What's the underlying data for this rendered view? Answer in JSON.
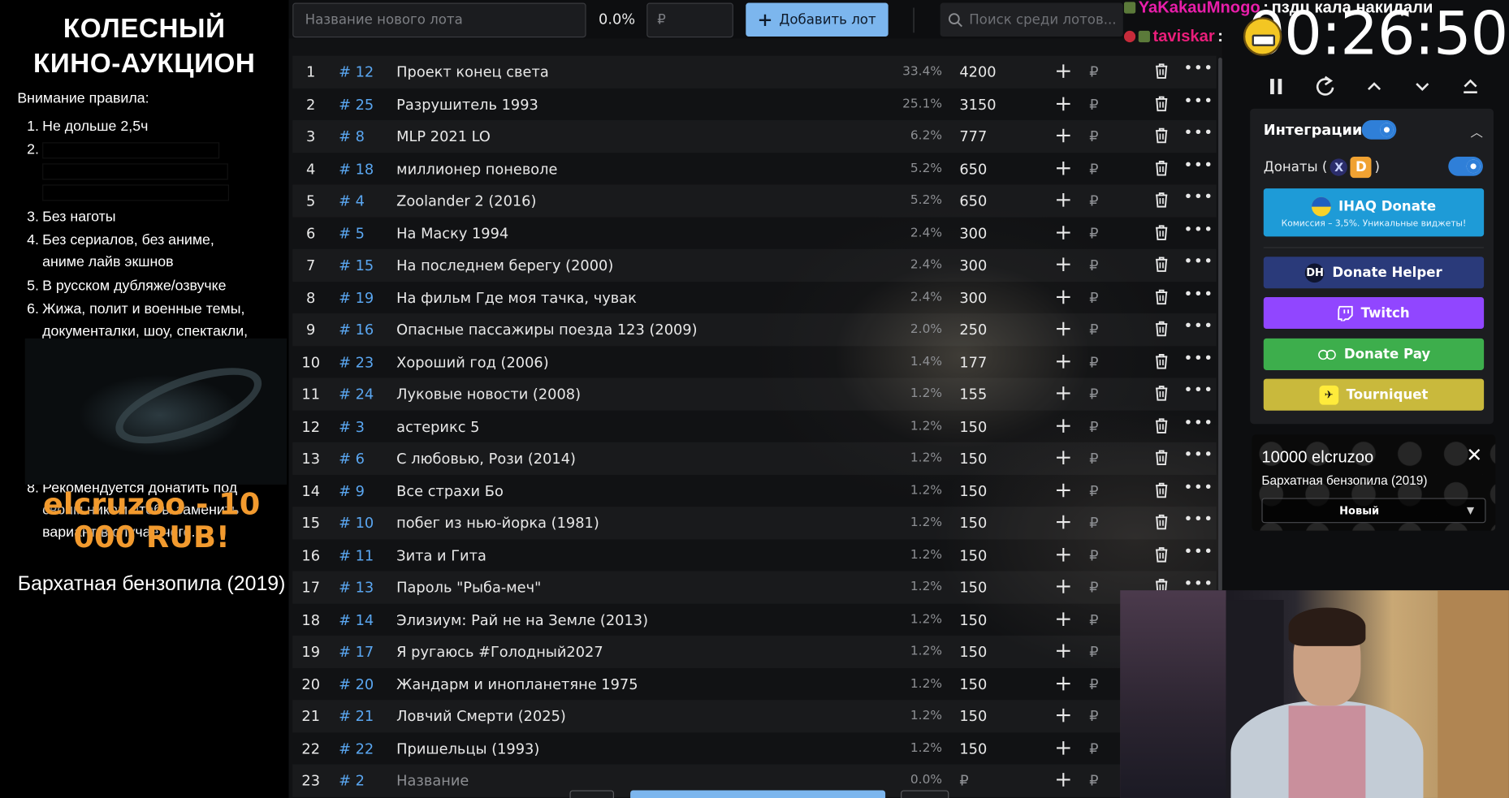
{
  "app": {
    "title_line1": "КОЛЕСНЫЙ",
    "title_line2": "КИНО-АУКЦИОН"
  },
  "rules": {
    "heading": "Внимание правила:",
    "items": [
      {
        "num": "1.",
        "lines": [
          "Не дольше 2,5ч"
        ]
      },
      {
        "num": "2.",
        "lines": []
      },
      {
        "num": "3.",
        "lines": [
          "Без наготы"
        ]
      },
      {
        "num": "4.",
        "lines": [
          "Без сериалов, без аниме,",
          "аниме лайв экшнов"
        ]
      },
      {
        "num": "5.",
        "lines": [
          "В русском дубляже/озвучке"
        ]
      },
      {
        "num": "6.",
        "lines": [
          "Жижа, полит и военные темы,",
          "документалки, шоу, спектакли,"
        ]
      },
      {
        "num": "8.",
        "lines": [
          "Рекомендуется донатить под",
          "своим ником чтобы заменить",
          "вариант в случае чего."
        ]
      }
    ]
  },
  "donation_alert": {
    "text": "elcruzoo - 10 000 RUB!",
    "movie": "Бархатная бензопила (2019)"
  },
  "toolbar": {
    "lot_name_placeholder": "Название нового лота",
    "new_percent": "0.0%",
    "amount_placeholder": "₽",
    "add_label": "Добавить лот",
    "search_placeholder": "Поиск среди лотов..."
  },
  "lots": [
    {
      "idx": "1",
      "id": "# 12",
      "name": "Проект конец света",
      "pct": "33.4%",
      "amount": "4200"
    },
    {
      "idx": "2",
      "id": "# 25",
      "name": "Разрушитель 1993",
      "pct": "25.1%",
      "amount": "3150"
    },
    {
      "idx": "3",
      "id": "# 8",
      "name": "MLP 2021 LO",
      "pct": "6.2%",
      "amount": "777"
    },
    {
      "idx": "4",
      "id": "# 18",
      "name": "миллионер поневоле",
      "pct": "5.2%",
      "amount": "650"
    },
    {
      "idx": "5",
      "id": "# 4",
      "name": "Zoolander 2 (2016)",
      "pct": "5.2%",
      "amount": "650"
    },
    {
      "idx": "6",
      "id": "# 5",
      "name": "На Маску 1994",
      "pct": "2.4%",
      "amount": "300"
    },
    {
      "idx": "7",
      "id": "# 15",
      "name": "На последнем берегу (2000)",
      "pct": "2.4%",
      "amount": "300"
    },
    {
      "idx": "8",
      "id": "# 19",
      "name": "На фильм Где моя тачка, чувак",
      "pct": "2.4%",
      "amount": "300"
    },
    {
      "idx": "9",
      "id": "# 16",
      "name": "Опасные пассажиры поезда 123 (2009)",
      "pct": "2.0%",
      "amount": "250"
    },
    {
      "idx": "10",
      "id": "# 23",
      "name": "Хороший год (2006)",
      "pct": "1.4%",
      "amount": "177"
    },
    {
      "idx": "11",
      "id": "# 24",
      "name": "Луковые новости (2008)",
      "pct": "1.2%",
      "amount": "155"
    },
    {
      "idx": "12",
      "id": "# 3",
      "name": "астерикс 5",
      "pct": "1.2%",
      "amount": "150"
    },
    {
      "idx": "13",
      "id": "# 6",
      "name": "С любовью, Рози (2014)",
      "pct": "1.2%",
      "amount": "150"
    },
    {
      "idx": "14",
      "id": "# 9",
      "name": "Все страхи Бо",
      "pct": "1.2%",
      "amount": "150"
    },
    {
      "idx": "15",
      "id": "# 10",
      "name": "побег из нью-йорка (1981)",
      "pct": "1.2%",
      "amount": "150"
    },
    {
      "idx": "16",
      "id": "# 11",
      "name": "Зита и Гита",
      "pct": "1.2%",
      "amount": "150"
    },
    {
      "idx": "17",
      "id": "# 13",
      "name": "Пароль \"Рыба-меч\"",
      "pct": "1.2%",
      "amount": "150"
    },
    {
      "idx": "18",
      "id": "# 14",
      "name": "Элизиум: Рай не на Земле (2013)",
      "pct": "1.2%",
      "amount": "150"
    },
    {
      "idx": "19",
      "id": "# 17",
      "name": "Я ругаюсь #Голодный2027",
      "pct": "1.2%",
      "amount": "150"
    },
    {
      "idx": "20",
      "id": "# 20",
      "name": "Жандарм и инопланетяне 1975",
      "pct": "1.2%",
      "amount": "150"
    },
    {
      "idx": "21",
      "id": "# 21",
      "name": "Ловчий Смерти (2025)",
      "pct": "1.2%",
      "amount": "150"
    },
    {
      "idx": "22",
      "id": "# 22",
      "name": "Пришельцы (1993)",
      "pct": "1.2%",
      "amount": "150"
    },
    {
      "idx": "23",
      "id": "# 2",
      "name": "Название",
      "pct": "0.0%",
      "amount": "₽",
      "empty": true
    }
  ],
  "lot_currency": "₽",
  "chat": [
    {
      "user": "YaKakauMnogo",
      "message": "пздц кала накидали"
    },
    {
      "user": "taviskar",
      "message": ""
    }
  ],
  "timer": "00:26:50",
  "integrations": {
    "heading": "Интеграции",
    "donates_label": "Донаты (",
    "donates_close": ")",
    "services": {
      "ihaq": {
        "label": "IHAQ Donate",
        "sub": "Комиссия – 3,5%. Уникальные виджеты!"
      },
      "donate_helper": "Donate Helper",
      "twitch": "Twitch",
      "donate_pay": "Donate Pay",
      "tourniquet": "Tourniquet"
    }
  },
  "bid_card": {
    "title": "10000 elcruzoo",
    "movie": "Бархатная бензопила (2019)",
    "select_value": "Новый"
  },
  "colors": {
    "accent_blue": "#7cb6ee",
    "id_blue": "#5aa6f0",
    "donation_orange": "#f29a2e",
    "ihaq": "#1e9bd7",
    "donate_helper": "#2a3a7a",
    "twitch": "#9146ff",
    "donate_pay": "#3dae4c",
    "tourniquet": "#c9b93c"
  }
}
